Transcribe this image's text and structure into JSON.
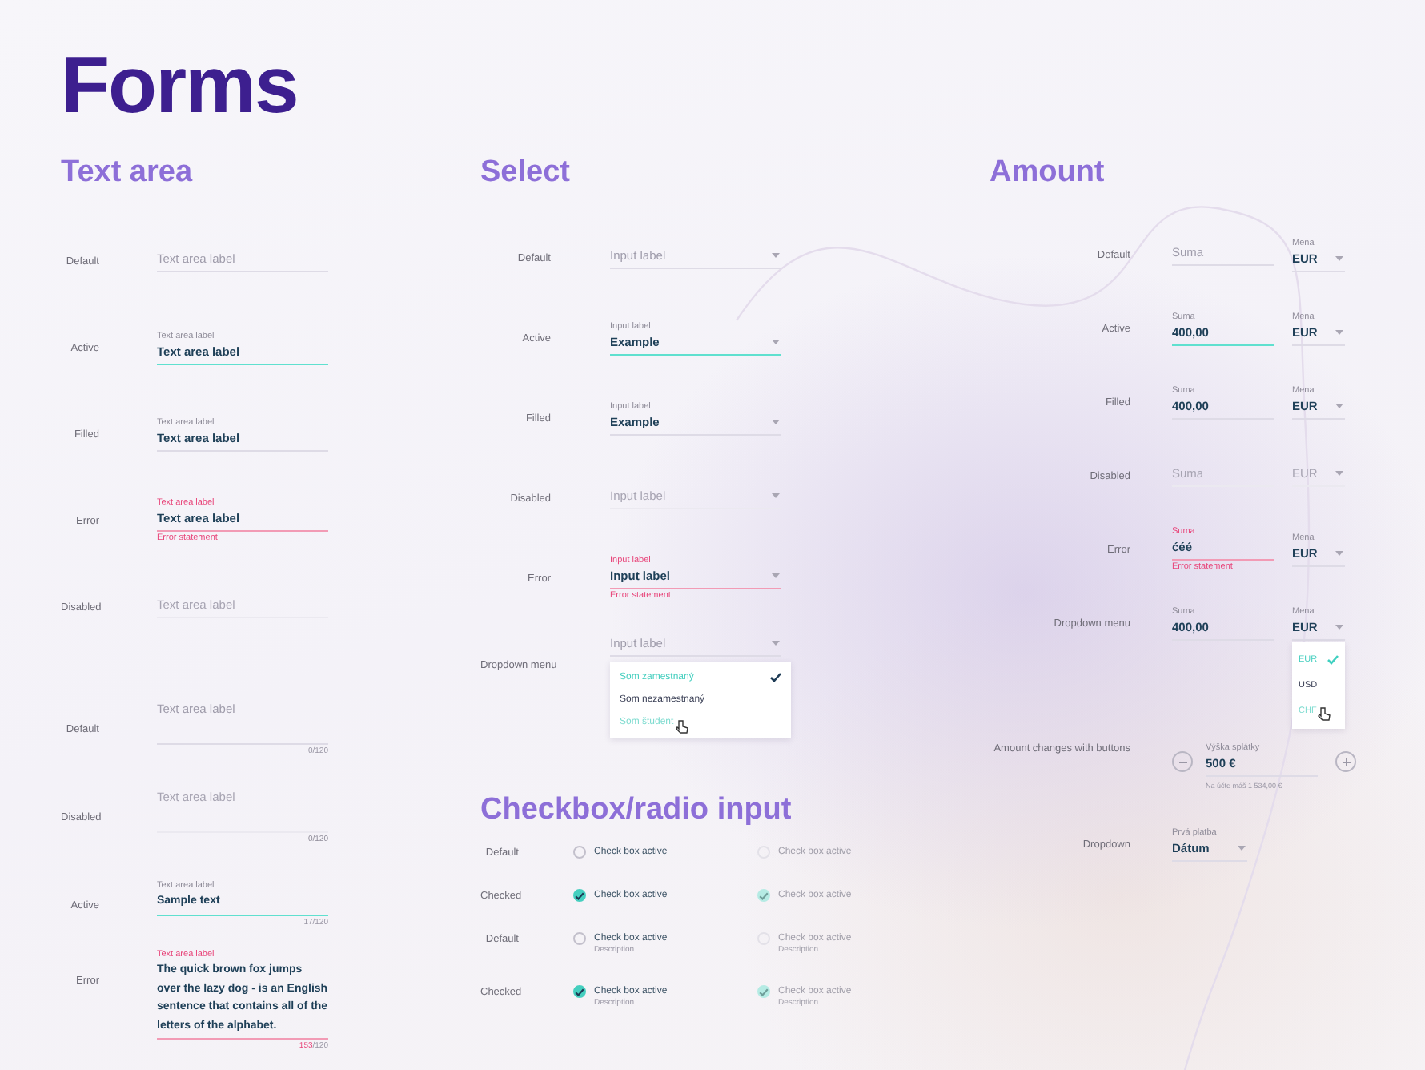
{
  "title": "Forms",
  "text_area": {
    "title": "Text area",
    "rows": [
      {
        "name": "Default",
        "multiline": false,
        "active": false,
        "invalid": false,
        "disabled": false,
        "placeholder": "Text area label"
      },
      {
        "name": "Active",
        "multiline": false,
        "active": true,
        "invalid": false,
        "disabled": false,
        "label": "Text area label",
        "value": "Text area label"
      },
      {
        "name": "Filled",
        "multiline": false,
        "active": false,
        "invalid": false,
        "disabled": false,
        "label": "Text area label",
        "value": "Text area label"
      },
      {
        "name": "Error",
        "multiline": false,
        "active": false,
        "invalid": true,
        "disabled": false,
        "label": "Text area label",
        "value": "Text area label",
        "error": "Error statement"
      },
      {
        "name": "Disabled",
        "multiline": false,
        "active": false,
        "invalid": false,
        "disabled": true,
        "placeholder": "Text area label"
      },
      {
        "name": "Default",
        "multiline": true,
        "active": false,
        "invalid": false,
        "disabled": false,
        "placeholder": "Text area label",
        "count": "0",
        "limit": "/120"
      },
      {
        "name": "Disabled",
        "multiline": true,
        "active": false,
        "invalid": false,
        "disabled": true,
        "placeholder": "Text area label",
        "count": "0",
        "limit": "/120"
      },
      {
        "name": "Active",
        "multiline": true,
        "active": true,
        "invalid": false,
        "disabled": false,
        "label": "Text area label",
        "value": "Sample text",
        "count": "17",
        "limit": "/120"
      },
      {
        "name": "Error",
        "multiline": true,
        "active": false,
        "invalid": true,
        "disabled": false,
        "label": "Text area label",
        "value": "The quick brown fox jumps over the lazy dog - is an English sentence that contains all of the letters of the alphabet.",
        "count": "153",
        "limit": "/120"
      }
    ]
  },
  "select": {
    "title": "Select",
    "rows": [
      {
        "name": "Default",
        "active": false,
        "invalid": false,
        "disabled": false,
        "placeholder": "Input label"
      },
      {
        "name": "Active",
        "active": true,
        "invalid": false,
        "disabled": false,
        "label": "Input label",
        "value": "Example"
      },
      {
        "name": "Filled",
        "active": false,
        "invalid": false,
        "disabled": false,
        "label": "Input label",
        "value": "Example"
      },
      {
        "name": "Disabled",
        "active": false,
        "invalid": false,
        "disabled": true,
        "placeholder": "Input label"
      },
      {
        "name": "Error",
        "active": false,
        "invalid": true,
        "disabled": false,
        "label": "Input label",
        "value": "Input label",
        "error": "Error statement"
      },
      {
        "name": "Dropdown menu",
        "active": false,
        "invalid": false,
        "disabled": false,
        "placeholder": "Input label",
        "options": [
          {
            "label": "Som zamestnaný",
            "selected": true,
            "hovered": false
          },
          {
            "label": "Som nezamestnaný",
            "selected": false,
            "hovered": false
          },
          {
            "label": "Som študent",
            "selected": false,
            "hovered": true
          }
        ]
      }
    ]
  },
  "checkbox": {
    "title": "Checkbox/radio input",
    "rows": [
      {
        "name": "Default",
        "items": [
          {
            "label": "Check box active",
            "checked": false,
            "disabled": false
          },
          {
            "label": "Check box active",
            "checked": false,
            "disabled": true
          }
        ]
      },
      {
        "name": "Checked",
        "items": [
          {
            "label": "Check box active",
            "checked": true,
            "disabled": false
          },
          {
            "label": "Check box active",
            "checked": true,
            "disabled": true
          }
        ]
      },
      {
        "name": "Default",
        "items": [
          {
            "label": "Check box active",
            "description": "Description",
            "checked": false,
            "disabled": false
          },
          {
            "label": "Check box active",
            "description": "Description",
            "checked": false,
            "disabled": true
          }
        ]
      },
      {
        "name": "Checked",
        "items": [
          {
            "label": "Check box active",
            "description": "Description",
            "checked": true,
            "disabled": false
          },
          {
            "label": "Check box active",
            "description": "Description",
            "checked": true,
            "disabled": true
          }
        ]
      }
    ]
  },
  "amount": {
    "title": "Amount",
    "rows": [
      {
        "name": "Default",
        "kind": "amount",
        "active": false,
        "invalid": false,
        "disabled": false,
        "placeholder": "Suma",
        "currency_label": "Mena",
        "currency": "EUR"
      },
      {
        "name": "Active",
        "kind": "amount",
        "active": true,
        "invalid": false,
        "disabled": false,
        "label": "Suma",
        "value": "400,00",
        "currency_label": "Mena",
        "currency": "EUR"
      },
      {
        "name": "Filled",
        "kind": "amount",
        "active": false,
        "invalid": false,
        "disabled": false,
        "label": "Suma",
        "value": "400,00",
        "currency_label": "Mena",
        "currency": "EUR"
      },
      {
        "name": "Disabled",
        "kind": "amount",
        "active": false,
        "invalid": false,
        "disabled": true,
        "placeholder": "Suma",
        "currency": "EUR"
      },
      {
        "name": "Error",
        "kind": "amount",
        "active": false,
        "invalid": true,
        "disabled": false,
        "label": "Suma",
        "value": "ćéé",
        "error": "Error statement",
        "currency_label": "Mena",
        "currency": "EUR"
      },
      {
        "name": "Dropdown menu",
        "kind": "amount",
        "active": false,
        "invalid": false,
        "disabled": false,
        "label": "Suma",
        "value": "400,00",
        "currency_label": "Mena",
        "currency": "EUR",
        "options": [
          {
            "label": "EUR",
            "selected": true,
            "hovered": false
          },
          {
            "label": "USD",
            "selected": false,
            "hovered": false
          },
          {
            "label": "CHF",
            "selected": false,
            "hovered": true
          }
        ]
      },
      {
        "name": "Amount changes with buttons",
        "kind": "stepper",
        "label": "Výška splátky",
        "value": "500 €",
        "hint": "Na účte máš 1 534,00 €"
      },
      {
        "name": "Dropdown",
        "kind": "dropdown",
        "label": "Prvá platba",
        "value": "Dátum"
      }
    ]
  }
}
